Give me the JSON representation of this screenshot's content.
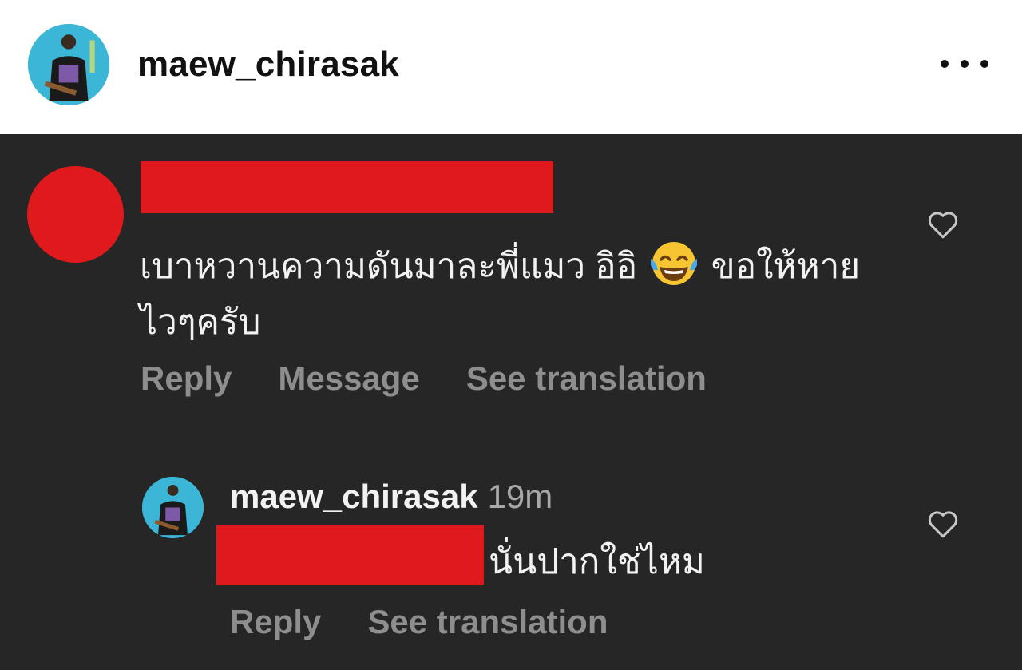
{
  "post_header": {
    "username": "maew_chirasak",
    "more_icon": "more-horizontal-icon"
  },
  "comment": {
    "avatar_color": "#e0191c",
    "text_part1": "เบาหวานความดันมาละพี่แมว อิอิ",
    "emoji": "face-with-tears-of-joy",
    "text_part2": "ขอให้หายไวๆครับ",
    "reply_label": "Reply",
    "message_label": "Message",
    "see_translation_label": "See translation",
    "like_icon": "heart-outline-icon"
  },
  "reply": {
    "username": "maew_chirasak",
    "time": "19m",
    "text": "นั่นปากใช่ไหม",
    "reply_label": "Reply",
    "see_translation_label": "See translation",
    "like_icon": "heart-outline-icon"
  },
  "colors": {
    "background_dark": "#262626",
    "header_bg": "#ffffff",
    "redaction": "#e0191c",
    "secondary_text": "#8e8e8e",
    "avatar_bg": "#3bb6d6"
  }
}
